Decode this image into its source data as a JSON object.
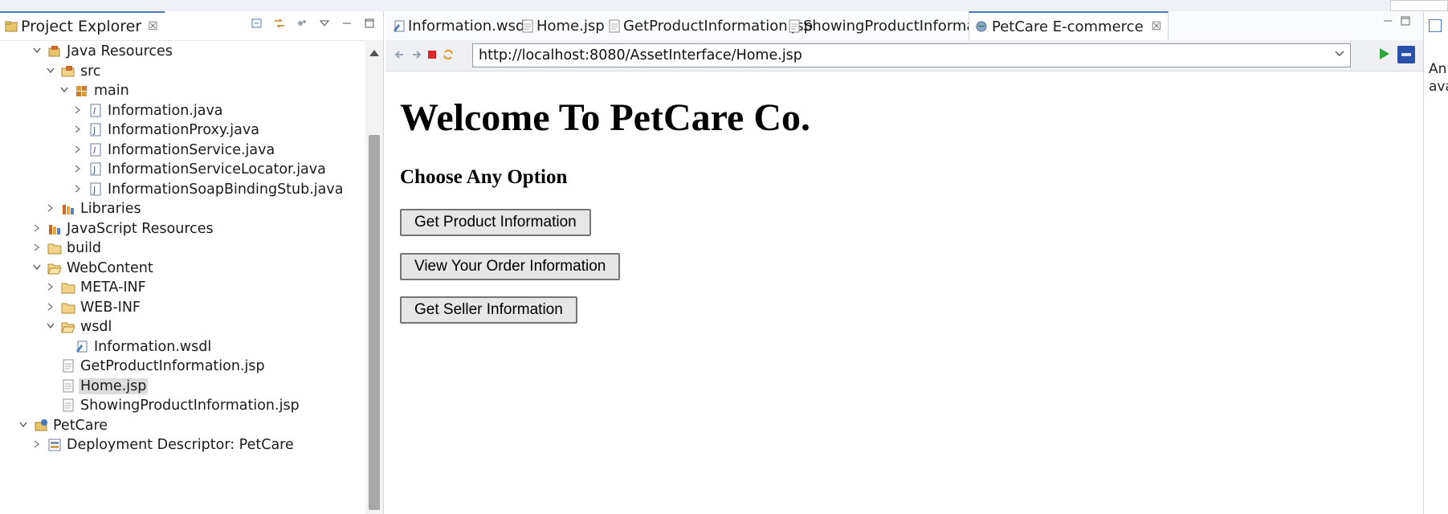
{
  "explorer": {
    "tab_label": "Project Explorer",
    "close_glyph": "☒"
  },
  "tree": [
    {
      "label": "Java Resources",
      "indent": 1,
      "expanded": true,
      "icon": "java-resources-icon"
    },
    {
      "label": "src",
      "indent": 2,
      "expanded": true,
      "icon": "source-folder-icon"
    },
    {
      "label": "main",
      "indent": 3,
      "expanded": true,
      "icon": "package-icon"
    },
    {
      "label": "Information.java",
      "indent": 4,
      "expanded": false,
      "icon": "interface-file-icon"
    },
    {
      "label": "InformationProxy.java",
      "indent": 4,
      "expanded": false,
      "icon": "java-file-icon"
    },
    {
      "label": "InformationService.java",
      "indent": 4,
      "expanded": false,
      "icon": "interface-file-icon"
    },
    {
      "label": "InformationServiceLocator.java",
      "indent": 4,
      "expanded": false,
      "icon": "java-file-icon"
    },
    {
      "label": "InformationSoapBindingStub.java",
      "indent": 4,
      "expanded": false,
      "icon": "java-file-icon"
    },
    {
      "label": "Libraries",
      "indent": 2,
      "expanded": false,
      "icon": "libraries-icon"
    },
    {
      "label": "JavaScript Resources",
      "indent": 1,
      "expanded": false,
      "icon": "libraries-icon"
    },
    {
      "label": "build",
      "indent": 1,
      "expanded": false,
      "icon": "folder-icon"
    },
    {
      "label": "WebContent",
      "indent": 1,
      "expanded": true,
      "icon": "folder-open-icon"
    },
    {
      "label": "META-INF",
      "indent": 2,
      "expanded": false,
      "icon": "folder-icon"
    },
    {
      "label": "WEB-INF",
      "indent": 2,
      "expanded": false,
      "icon": "folder-icon"
    },
    {
      "label": "wsdl",
      "indent": 2,
      "expanded": true,
      "icon": "folder-open-icon"
    },
    {
      "label": "Information.wsdl",
      "indent": 3,
      "expanded": null,
      "icon": "wsdl-file-icon"
    },
    {
      "label": "GetProductInformation.jsp",
      "indent": 2,
      "expanded": null,
      "icon": "jsp-file-icon"
    },
    {
      "label": "Home.jsp",
      "indent": 2,
      "expanded": null,
      "icon": "jsp-file-icon",
      "selected": true
    },
    {
      "label": "ShowingProductInformation.jsp",
      "indent": 2,
      "expanded": null,
      "icon": "jsp-file-icon"
    },
    {
      "label": "PetCare",
      "indent": 0,
      "expanded": true,
      "icon": "project-icon"
    },
    {
      "label": "Deployment Descriptor: PetCare",
      "indent": 1,
      "expanded": false,
      "icon": "deployment-descriptor-icon"
    }
  ],
  "editor_tabs": [
    {
      "label": "Information.wsdl",
      "icon": "wsdl-file-icon",
      "active": false
    },
    {
      "label": "Home.jsp",
      "icon": "jsp-file-icon",
      "active": false
    },
    {
      "label": "GetProductInformation.jsp",
      "icon": "jsp-file-icon",
      "active": false
    },
    {
      "label": "ShowingProductInformation.jsp",
      "icon": "jsp-file-icon",
      "active": false
    },
    {
      "label": "PetCare E-commerce",
      "icon": "globe-icon",
      "active": true
    }
  ],
  "browser": {
    "url": "http://localhost:8080/AssetInterface/Home.jsp"
  },
  "page": {
    "heading": "Welcome To PetCare Co.",
    "subheading": "Choose Any Option",
    "buttons": [
      "Get Product Information",
      "View Your Order Information",
      "Get Seller Information"
    ]
  },
  "right_panel": {
    "line1": "An",
    "line2": "ava"
  },
  "colors": {
    "accent": "#4a78b8",
    "selection": "#dcdcdc",
    "go_green": "#2fa53c"
  }
}
